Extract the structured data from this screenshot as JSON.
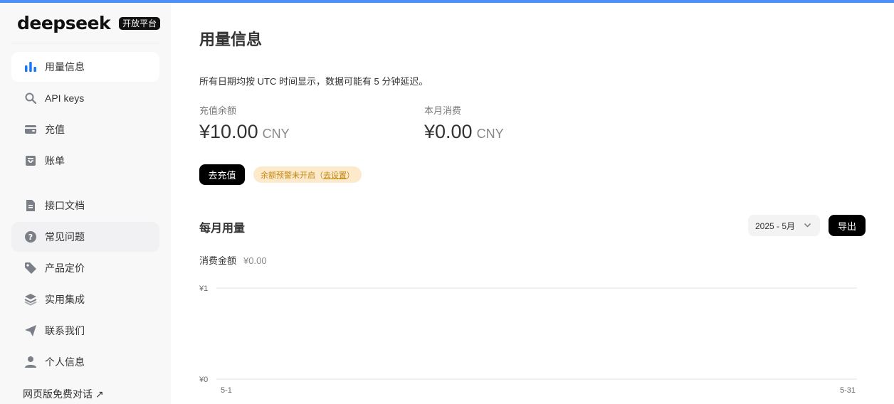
{
  "brand": {
    "logo": "deepseek",
    "badge": "开放平台"
  },
  "sidebar": {
    "items": [
      {
        "label": "用量信息",
        "icon": "bar-chart-icon"
      },
      {
        "label": "API keys",
        "icon": "search-key-icon"
      },
      {
        "label": "充值",
        "icon": "wallet-icon"
      },
      {
        "label": "账单",
        "icon": "inbox-icon"
      },
      {
        "label": "接口文档",
        "icon": "document-icon"
      },
      {
        "label": "常见问题",
        "icon": "help-icon"
      },
      {
        "label": "产品定价",
        "icon": "tag-icon"
      },
      {
        "label": "实用集成",
        "icon": "layers-icon"
      },
      {
        "label": "联系我们",
        "icon": "send-icon"
      },
      {
        "label": "个人信息",
        "icon": "user-icon"
      }
    ],
    "web_chat": "网页版免费对话 ↗"
  },
  "main": {
    "title": "用量信息",
    "notice": "所有日期均按 UTC 时间显示，数据可能有 5 分钟延迟。",
    "balance": {
      "label": "充值余额",
      "value": "¥10.00",
      "unit": "CNY"
    },
    "monthly": {
      "label": "本月消费",
      "value": "¥0.00",
      "unit": "CNY"
    },
    "recharge_button": "去充值",
    "warning": {
      "text": "余额预警未开启（",
      "link": "去设置",
      "suffix": "）"
    },
    "section_title": "每月用量",
    "month_select": "2025 - 5月",
    "export_button": "导出",
    "consume_label": "消费金额",
    "consume_value": "¥0.00"
  },
  "colors": {
    "accent": "#4d8ff7",
    "active_icon": "#1677ff",
    "icon_gray": "#7b7f87",
    "warning_bg": "#fde9cc",
    "warning_text": "#c4870c"
  },
  "chart_data": {
    "type": "bar",
    "x_tick_labels": [
      "5-1",
      "5-31"
    ],
    "y_tick_labels": [
      "¥1",
      "¥0"
    ],
    "ylim": [
      0,
      1
    ],
    "values": [],
    "grid": true
  }
}
